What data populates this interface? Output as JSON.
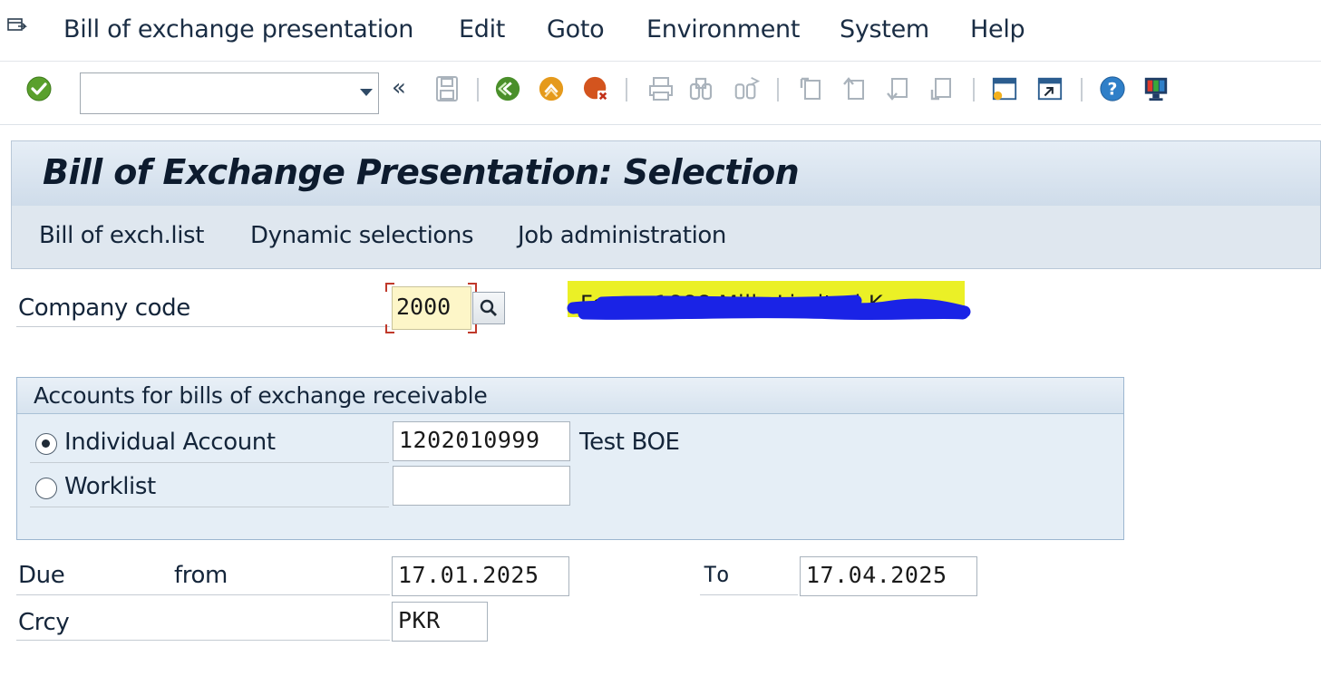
{
  "menu": {
    "items": [
      "Bill of exchange presentation",
      "Edit",
      "Goto",
      "Environment",
      "System",
      "Help"
    ]
  },
  "toolbar": {
    "command_value": "",
    "icons": [
      "check-icon",
      "command-field",
      "collapse-icon",
      "save-icon",
      "back-icon",
      "exit-icon",
      "cancel-icon",
      "print-icon",
      "find-icon",
      "find-next-icon",
      "first-page-icon",
      "previous-page-icon",
      "next-page-icon",
      "last-page-icon",
      "create-session-icon",
      "shortcut-icon",
      "help-icon",
      "customize-layout-icon"
    ]
  },
  "title": "Bill of Exchange Presentation: Selection",
  "appbar": {
    "items": [
      "Bill of exch.list",
      "Dynamic selections",
      "Job administration"
    ]
  },
  "company": {
    "label": "Company code",
    "value": "2000",
    "name_redacted": "Feroze1888 Mills Limited K..."
  },
  "accounts": {
    "title": "Accounts for bills of exchange receivable",
    "individual_label": "Individual Account",
    "individual_value": "1202010999",
    "individual_desc": "Test BOE",
    "worklist_label": "Worklist",
    "worklist_value": "",
    "selected": "individual"
  },
  "due": {
    "label": "Due",
    "from_label": "from",
    "from_value": "17.01.2025",
    "to_label": "To",
    "to_value": "17.04.2025"
  },
  "currency": {
    "label": "Crcy",
    "value": "PKR"
  },
  "colors": {
    "accent": "#1a2d44",
    "highlight": "#ebf026",
    "redaction": "#1a23e6",
    "required_corner": "#c0392b"
  }
}
